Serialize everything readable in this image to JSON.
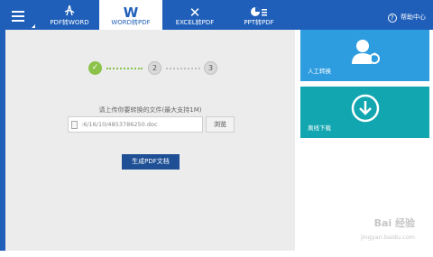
{
  "nav": {
    "tabs": [
      {
        "label": "PDF转WORD",
        "icon": "pdf-to-word-icon"
      },
      {
        "label": "WORD转PDF",
        "icon": "word-w-icon",
        "active": true
      },
      {
        "label": "EXCEL转PDF",
        "icon": "excel-x-icon"
      },
      {
        "label": "PPT转PDF",
        "icon": "ppt-chart-icon"
      }
    ],
    "help_label": "帮助中心",
    "help_icon_glyph": "?"
  },
  "steps": {
    "step1_glyph": "✓",
    "step2": "2",
    "step3": "3",
    "current": 1
  },
  "upload": {
    "label": "请上传你要转换的文件(最大支持1M)",
    "file_value": ":6/16/10/4853786250.doc",
    "browse_label": "浏览",
    "generate_label": "生成PDF文档"
  },
  "cards": {
    "manual_label": "人工转换",
    "manual_icon": "user-refresh-icon",
    "download_label": "离线下载",
    "download_icon": "download-circle-icon"
  },
  "watermark": {
    "title": "Bai 经验",
    "url": "jingyan.baidu.com"
  },
  "colors": {
    "brand_blue": "#1f5fb9",
    "step_done": "#8bc24a",
    "manual_card": "#2e9de0",
    "download_card": "#11a6b0",
    "generate_button": "#1f5096"
  }
}
